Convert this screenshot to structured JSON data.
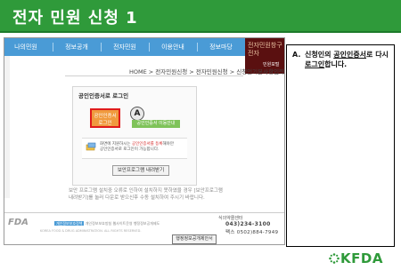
{
  "header": {
    "title": "전자 민원 신청 1"
  },
  "nav": {
    "items": [
      "나의민원",
      "정보공개",
      "전자민원",
      "이용안내",
      "정보마당"
    ]
  },
  "logo": {
    "line1": "전자민원창구",
    "line2": "전자",
    "line3": "민원포털"
  },
  "breadcrumb": "HOME > 전자민원신청 > 전자민원신청 > 신청인기본사항입력",
  "panel": {
    "title": "공인인증서로 로그인",
    "cert_login_line1": "공인인증서",
    "cert_login_line2": "로그인",
    "circle_label": "A",
    "cert_move_btn": "공인인증서 이동안내",
    "info_line1_pre": "화면에 지원하시는 ",
    "info_line1_hl": "공인인증서를 등록",
    "info_line1_post": "해야만",
    "info_line2": "공인인증서로 로그인이 가능합니다.",
    "download_btn": "보안프로그램 내려받기"
  },
  "desc": "보안 프로그램 설치중 오류로 인하여 설치하지 못하였을 경우 [보안프로그램 내려받기]를 눌러 다운로 받으신후 수동 설치하여 주시기 바랍니다.",
  "footer": {
    "logo": "FDA",
    "links": [
      "개인정보보호정책",
      "개인정보보호방침",
      "웹사이트운영",
      "행정정보공개제도"
    ],
    "copyright": "KOREA FOOD & DRUG ADMINISTRATION. ALL RIGHTS RESERVED.",
    "callcenter": "식의약콜센터",
    "phone1": "043)234-3100",
    "phone2": "팩스 0502)884-7949",
    "proposal_btn": "행정정보공개제안서"
  },
  "note": {
    "number": "A.",
    "text_pre": "신청인의 ",
    "text_u1": "공인인증서",
    "text_mid": "로 다시 ",
    "text_u2": "로그인",
    "text_post": "합니다."
  },
  "brand": {
    "name": "KFDA",
    "color": "#2f9a3a"
  }
}
